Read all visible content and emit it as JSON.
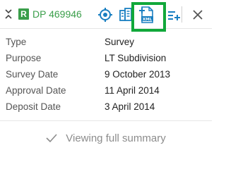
{
  "header": {
    "badge": "R",
    "plan_id": "DP 469946",
    "colors": {
      "green": "#3a9e4a",
      "blue": "#1a7fc1",
      "highlight": "#11a83a"
    },
    "icons": [
      "collapse-icon",
      "target-icon",
      "building-icon",
      "xml-document-icon",
      "add-to-list-icon",
      "close-icon"
    ]
  },
  "details": [
    {
      "label": "Type",
      "value": "Survey"
    },
    {
      "label": "Purpose",
      "value": "LT Subdivision"
    },
    {
      "label": "Survey Date",
      "value": "9 October 2013"
    },
    {
      "label": "Approval Date",
      "value": "11 April 2014"
    },
    {
      "label": "Deposit Date",
      "value": "3 April 2014"
    }
  ],
  "footer": {
    "text": "Viewing full summary"
  }
}
